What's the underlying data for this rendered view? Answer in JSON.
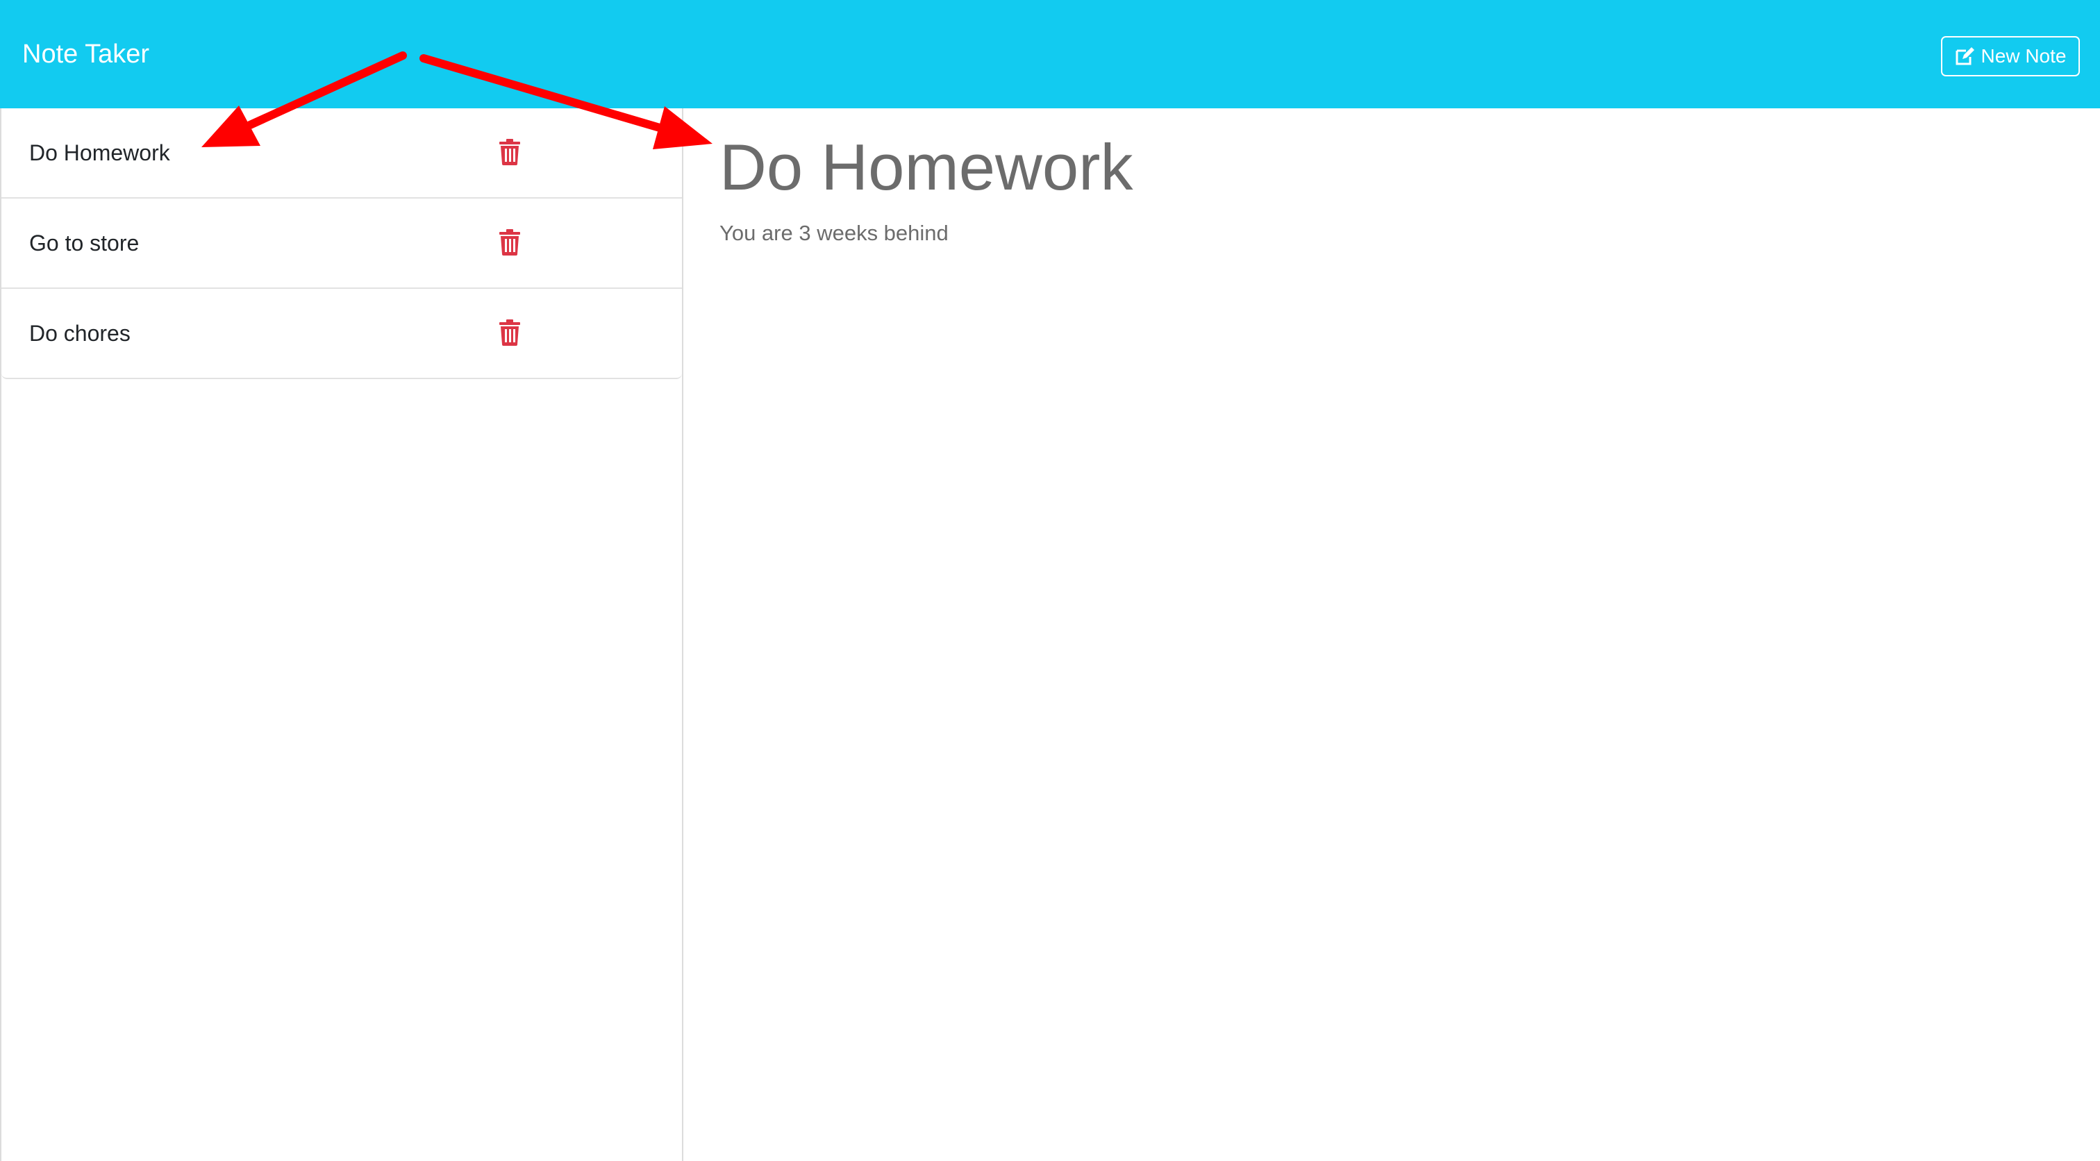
{
  "navbar": {
    "brand": "Note Taker",
    "new_note_label": "New Note",
    "background_color": "#12cbf0"
  },
  "sidebar": {
    "notes": [
      {
        "title": "Do Homework",
        "delete_icon": "trash-icon"
      },
      {
        "title": "Go to store",
        "delete_icon": "trash-icon"
      },
      {
        "title": "Do chores",
        "delete_icon": "trash-icon"
      }
    ]
  },
  "editor": {
    "title": "Do Homework",
    "text": "You are 3 weeks behind"
  },
  "colors": {
    "delete": "#dc3545",
    "annotation_arrow": "#ff0000",
    "muted_text": "#6c6c6c"
  }
}
